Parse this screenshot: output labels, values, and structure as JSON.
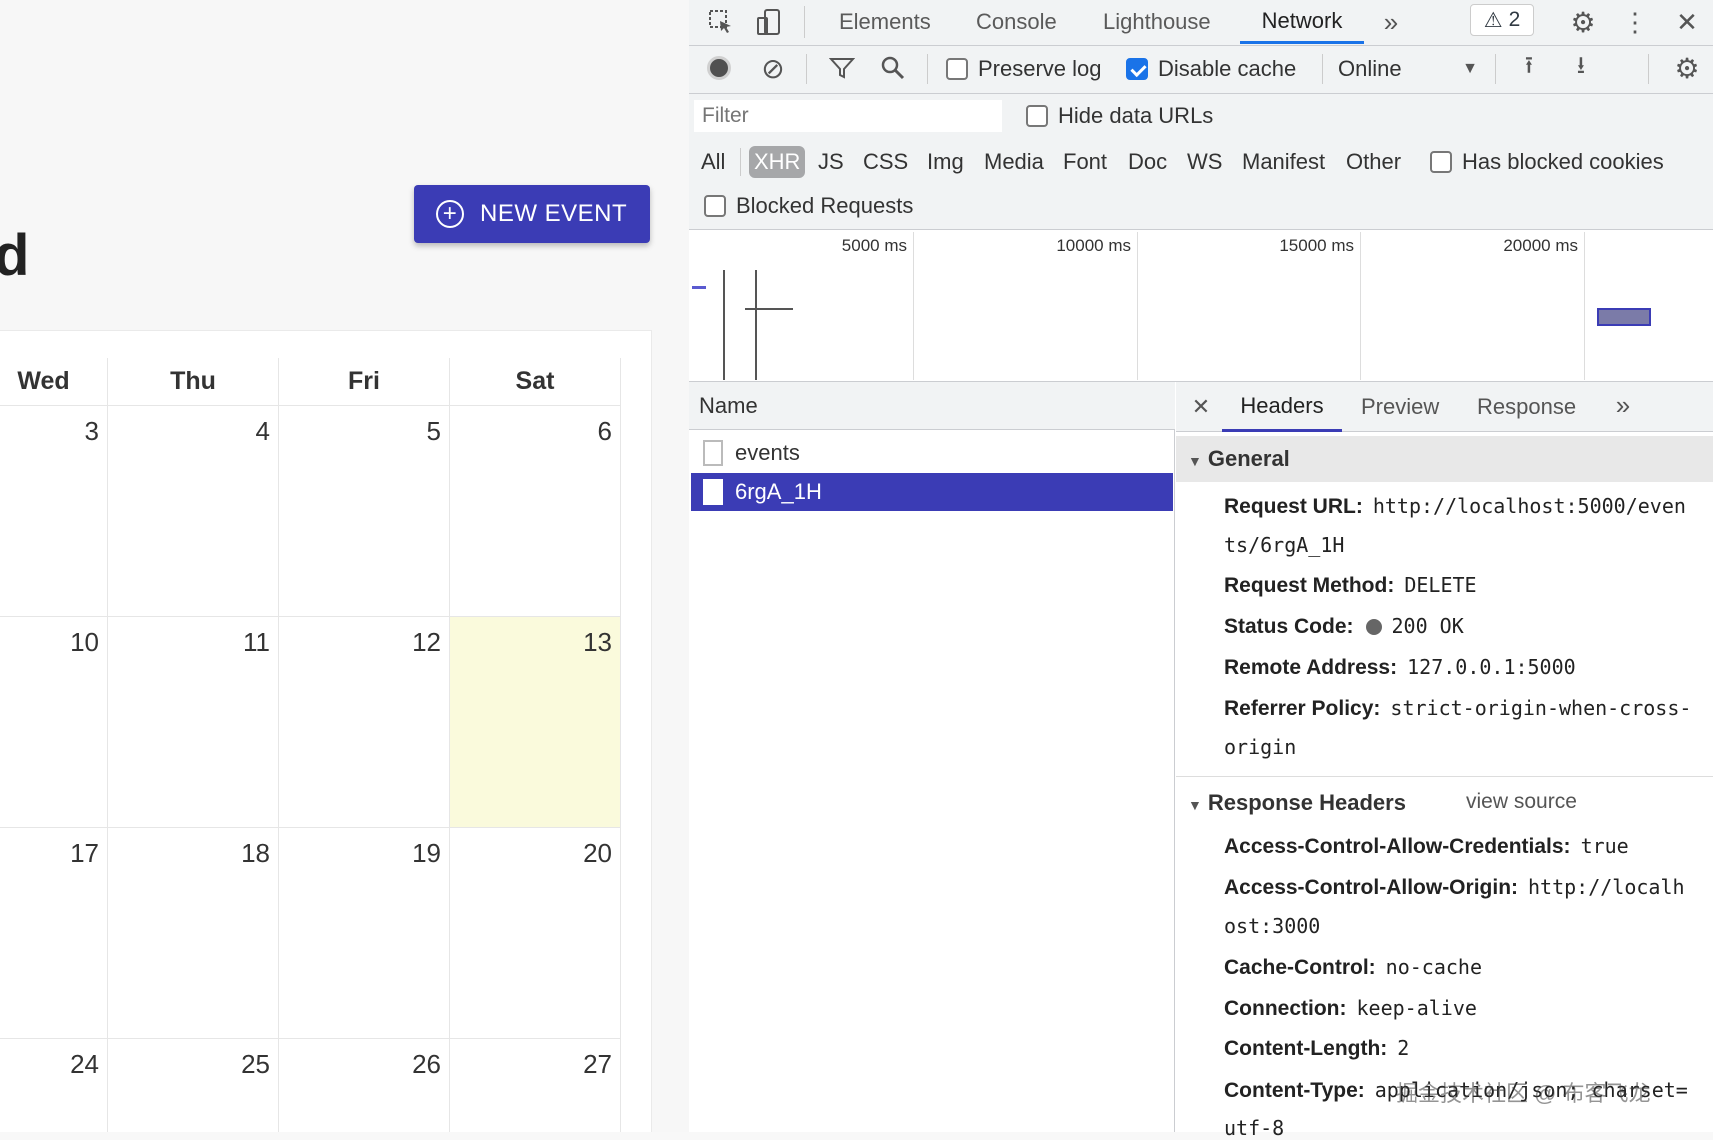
{
  "app": {
    "title_fragment": "d",
    "new_event_label": "NEW EVENT",
    "weekdays": [
      "Wed",
      "Thu",
      "Fri",
      "Sat"
    ],
    "weeks": [
      [
        "3",
        "4",
        "5",
        "6"
      ],
      [
        "10",
        "11",
        "12",
        "13"
      ],
      [
        "17",
        "18",
        "19",
        "20"
      ],
      [
        "24",
        "25",
        "26",
        "27"
      ]
    ]
  },
  "devtools": {
    "tabs": [
      "Elements",
      "Console",
      "Lighthouse",
      "Network"
    ],
    "active_tab": "Network",
    "warning_count": "2",
    "toolbar": {
      "preserve_log": "Preserve log",
      "disable_cache": "Disable cache",
      "throttle": "Online"
    },
    "filter_placeholder": "Filter",
    "hide_data_urls": "Hide data URLs",
    "type_filters": [
      "All",
      "XHR",
      "JS",
      "CSS",
      "Img",
      "Media",
      "Font",
      "Doc",
      "WS",
      "Manifest",
      "Other"
    ],
    "has_blocked_cookies": "Has blocked cookies",
    "blocked_requests": "Blocked Requests",
    "timeline_ticks": [
      "5000 ms",
      "10000 ms",
      "15000 ms",
      "20000 ms"
    ],
    "name_header": "Name",
    "requests": [
      "events",
      "6rgA_1H"
    ],
    "detail_tabs": [
      "Headers",
      "Preview",
      "Response"
    ],
    "general": {
      "title": "General",
      "request_url_label": "Request URL:",
      "request_url_1": "http://localhost:5000/even",
      "request_url_2": "ts/6rgA_1H",
      "method_label": "Request Method:",
      "method": "DELETE",
      "status_label": "Status Code:",
      "status": "200 OK",
      "remote_label": "Remote Address:",
      "remote": "127.0.0.1:5000",
      "referrer_label": "Referrer Policy:",
      "referrer_1": "strict-origin-when-cross-",
      "referrer_2": "origin"
    },
    "response_headers": {
      "title": "Response Headers",
      "view_source": "view source",
      "acac_label": "Access-Control-Allow-Credentials:",
      "acac": "true",
      "acao_label": "Access-Control-Allow-Origin:",
      "acao_1": "http://localh",
      "acao_2": "ost:3000",
      "cc_label": "Cache-Control:",
      "cc": "no-cache",
      "conn_label": "Connection:",
      "conn": "keep-alive",
      "cl_label": "Content-Length:",
      "cl": "2",
      "ct_label": "Content-Type:",
      "ct_1": "application/json; charset=",
      "ct_2": "utf-8"
    },
    "watermark": "掘金技术社区 @ 布客飞龙"
  }
}
